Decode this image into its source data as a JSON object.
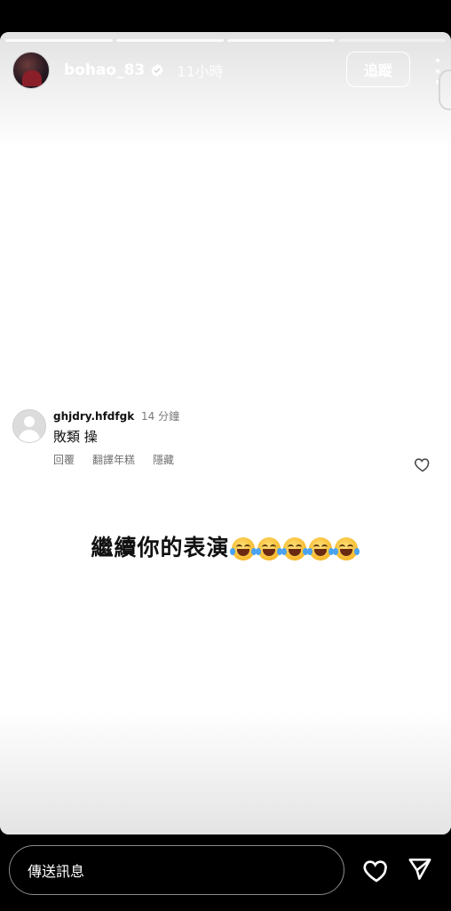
{
  "story": {
    "progress_segments": [
      {
        "state": "complete"
      },
      {
        "state": "complete"
      },
      {
        "state": "complete"
      },
      {
        "state": "active"
      }
    ],
    "user": {
      "username": "bohao_83",
      "verified": true,
      "time_ago": "11小時"
    },
    "follow_label": "追蹤",
    "icons": {
      "verified": "verified-badge-icon",
      "more": "more-vertical-icon",
      "heart": "heart-icon",
      "send": "send-icon"
    },
    "comment": {
      "username": "ghjdry.hfdfgk",
      "time_ago": "14 分鐘",
      "text": "敗類 操",
      "actions": {
        "reply": "回覆",
        "translate": "翻譯年糕",
        "hide": "隱藏"
      }
    },
    "caption": {
      "text": "繼續你的表演",
      "emoji": "face-with-tears-of-joy",
      "emoji_count": 5
    }
  },
  "composer": {
    "placeholder": "傳送訊息"
  },
  "colors": {
    "background": "#000000",
    "story_bg": "#ffffff",
    "comment_meta": "#7a7a7a"
  }
}
